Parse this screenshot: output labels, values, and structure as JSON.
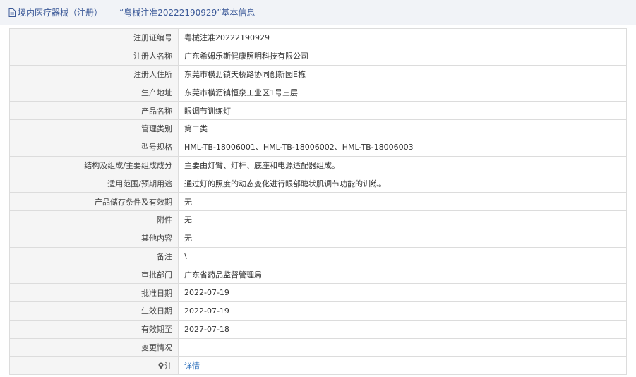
{
  "header": {
    "title": "境内医疗器械（注册）——“粤械注准20222190929”基本信息"
  },
  "rows": [
    {
      "label": "注册证编号",
      "value": "粤械注准20222190929"
    },
    {
      "label": "注册人名称",
      "value": "广东希姆乐斯健康照明科技有限公司"
    },
    {
      "label": "注册人住所",
      "value": "东莞市横沥镇天桥路协同创新园E栋"
    },
    {
      "label": "生产地址",
      "value": "东莞市横沥镇恒泉工业区1号三层"
    },
    {
      "label": "产品名称",
      "value": "眼调节训练灯"
    },
    {
      "label": "管理类别",
      "value": "第二类"
    },
    {
      "label": "型号规格",
      "value": "HML-TB-18006001、HML-TB-18006002、HML-TB-18006003"
    },
    {
      "label": "结构及组成/主要组成成分",
      "value": "主要由灯臂、灯杆、底座和电源适配器组成。"
    },
    {
      "label": "适用范围/预期用途",
      "value": "通过灯的照度的动态变化进行眼部睫状肌调节功能的训练。"
    },
    {
      "label": "产品储存条件及有效期",
      "value": "无"
    },
    {
      "label": "附件",
      "value": "无"
    },
    {
      "label": "其他内容",
      "value": "无"
    },
    {
      "label": "备注",
      "value": "\\"
    },
    {
      "label": "审批部门",
      "value": "广东省药品监督管理局"
    },
    {
      "label": "批准日期",
      "value": "2022-07-19"
    },
    {
      "label": "生效日期",
      "value": "2022-07-19"
    },
    {
      "label": "有效期至",
      "value": "2027-07-18"
    },
    {
      "label": "变更情况",
      "value": ""
    }
  ],
  "note_row": {
    "label": "注",
    "link_text": "详情"
  },
  "colors": {
    "header_bg": "#f1f3f7",
    "header_text": "#3b5998",
    "label_bg": "#f5f5f5",
    "border": "#dcdcdc",
    "link": "#2a6ebb"
  }
}
